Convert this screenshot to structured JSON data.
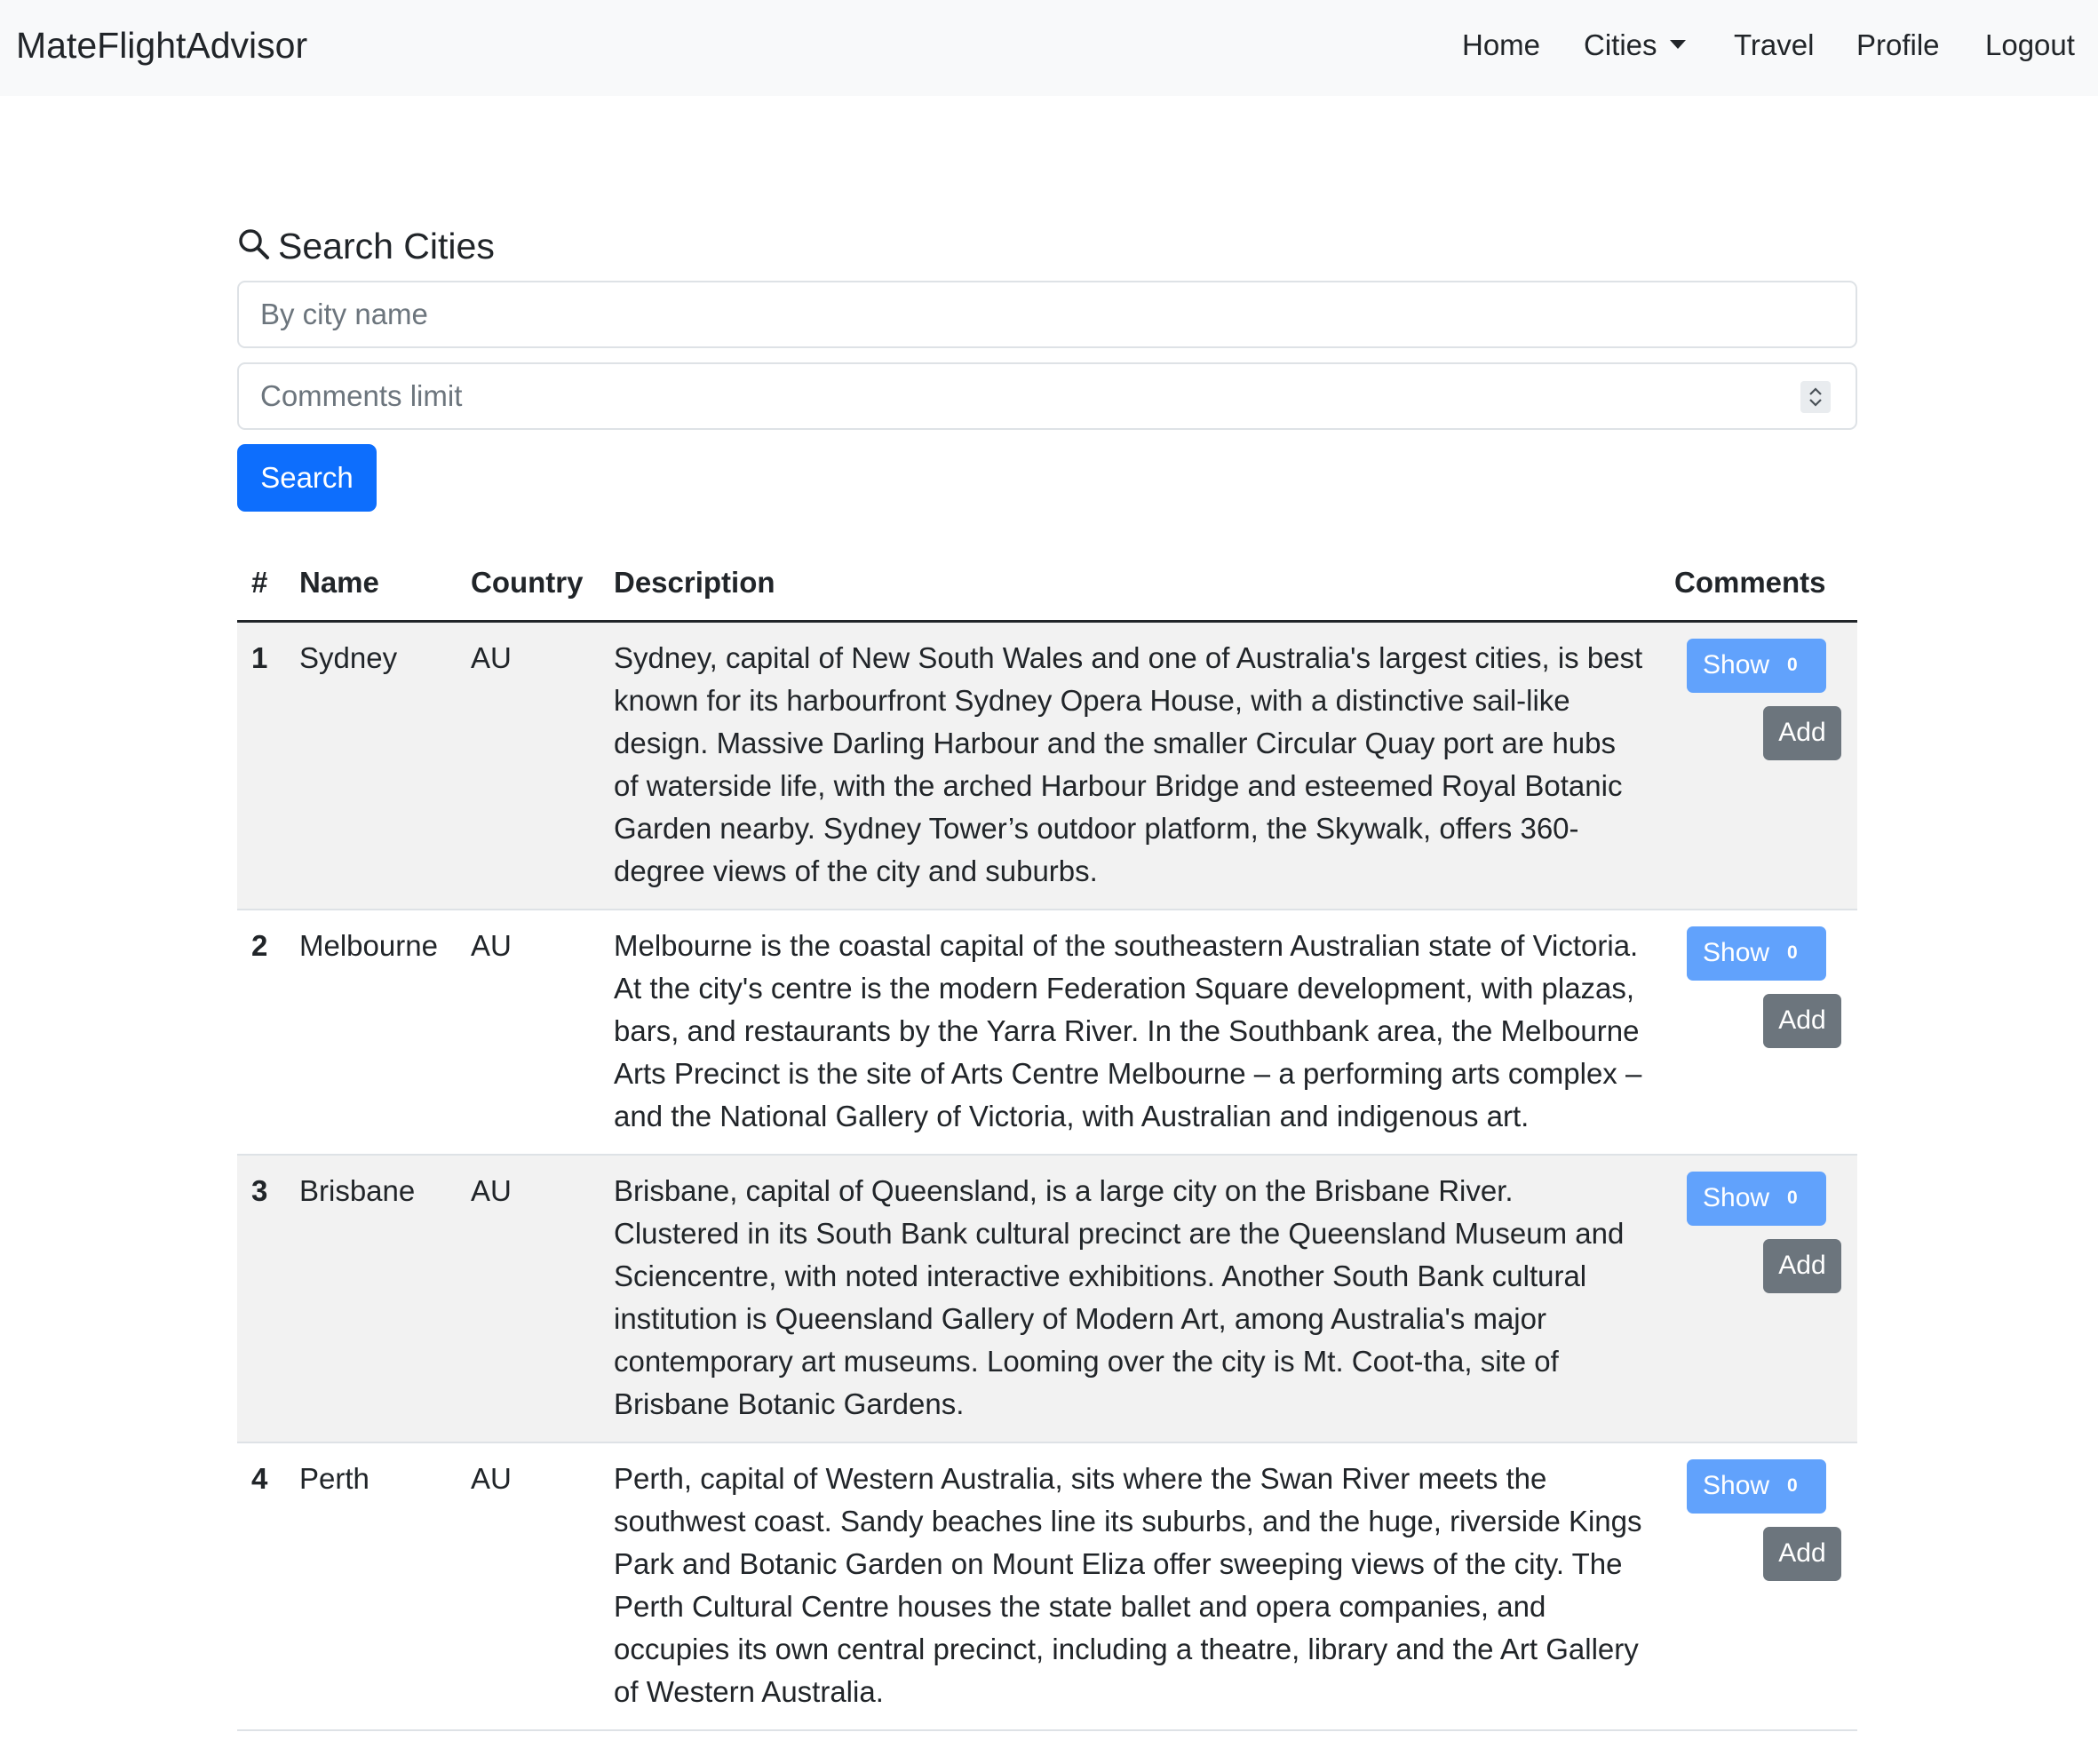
{
  "navbar": {
    "brand": "MateFlightAdvisor",
    "links": {
      "home": "Home",
      "cities": "Cities",
      "travel": "Travel",
      "profile": "Profile",
      "logout": "Logout"
    }
  },
  "search": {
    "heading": "Search Cities",
    "city_placeholder": "By city name",
    "limit_placeholder": "Comments limit",
    "button": "Search"
  },
  "table": {
    "headers": {
      "num": "#",
      "name": "Name",
      "country": "Country",
      "description": "Description",
      "comments": "Comments"
    },
    "rows": [
      {
        "num": "1",
        "name": "Sydney",
        "country": "AU",
        "description": "Sydney, capital of New South Wales and one of Australia's largest cities, is best known for its harbourfront Sydney Opera House, with a distinctive sail-like design. Massive Darling Harbour and the smaller Circular Quay port are hubs of waterside life, with the arched Harbour Bridge and esteemed Royal Botanic Garden nearby. Sydney Tower’s outdoor platform, the Skywalk, offers 360-degree views of the city and suburbs.",
        "show_label": "Show",
        "count": "0",
        "add_label": "Add"
      },
      {
        "num": "2",
        "name": "Melbourne",
        "country": "AU",
        "description": "Melbourne is the coastal capital of the southeastern Australian state of Victoria. At the city's centre is the modern Federation Square development, with plazas, bars, and restaurants by the Yarra River. In the Southbank area, the Melbourne Arts Precinct is the site of Arts Centre Melbourne – a performing arts complex – and the National Gallery of Victoria, with Australian and indigenous art.",
        "show_label": "Show",
        "count": "0",
        "add_label": "Add"
      },
      {
        "num": "3",
        "name": "Brisbane",
        "country": "AU",
        "description": "Brisbane, capital of Queensland, is a large city on the Brisbane River. Clustered in its South Bank cultural precinct are the Queensland Museum and Sciencentre, with noted interactive exhibitions. Another South Bank cultural institution is Queensland Gallery of Modern Art, among Australia's major contemporary art museums. Looming over the city is Mt. Coot-tha, site of Brisbane Botanic Gardens.",
        "show_label": "Show",
        "count": "0",
        "add_label": "Add"
      },
      {
        "num": "4",
        "name": "Perth",
        "country": "AU",
        "description": "Perth, capital of Western Australia, sits where the Swan River meets the southwest coast. Sandy beaches line its suburbs, and the huge, riverside Kings Park and Botanic Garden on Mount Eliza offer sweeping views of the city. The Perth Cultural Centre houses the state ballet and opera companies, and occupies its own central precinct, including a theatre, library and the Art Gallery of Western Australia.",
        "show_label": "Show",
        "count": "0",
        "add_label": "Add"
      }
    ]
  },
  "colors": {
    "primary": "#0d6efd",
    "show_button": "#61a2fc",
    "secondary": "#6c757d",
    "navbar_bg": "#f8f9fa",
    "striped_row": "#f2f2f2"
  },
  "icons": {
    "search": "search-icon",
    "dropdown": "caret-down-icon",
    "spinner": "updown-chevron-icon"
  }
}
